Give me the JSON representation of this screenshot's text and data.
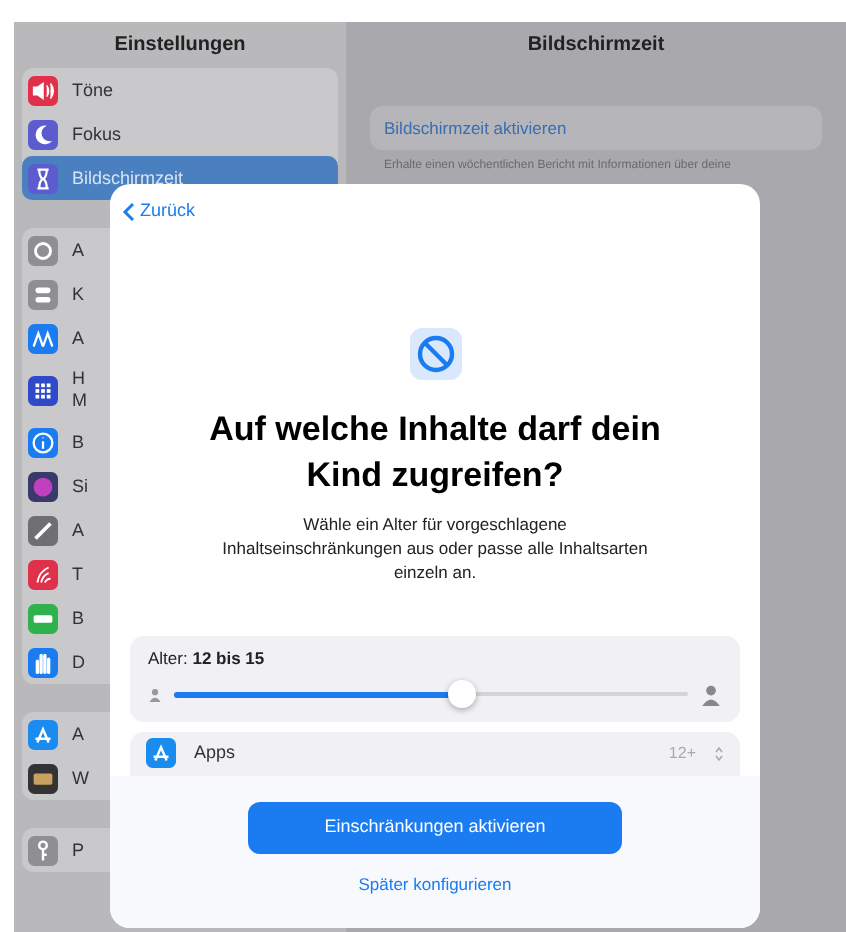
{
  "sidebar": {
    "title": "Einstellungen",
    "groups": [
      {
        "items": [
          {
            "label": "Töne",
            "selected": false
          },
          {
            "label": "Fokus",
            "selected": false
          },
          {
            "label": "Bildschirmzeit",
            "selected": true
          }
        ]
      },
      {
        "items": [
          {
            "label": "A",
            "selected": false
          },
          {
            "label": "K",
            "selected": false
          },
          {
            "label": "A",
            "selected": false
          },
          {
            "label": "H\nM",
            "selected": false
          },
          {
            "label": "B",
            "selected": false
          },
          {
            "label": "Si",
            "selected": false
          },
          {
            "label": "A",
            "selected": false
          },
          {
            "label": "T",
            "selected": false
          },
          {
            "label": "B",
            "selected": false
          },
          {
            "label": "D",
            "selected": false
          }
        ]
      },
      {
        "items": [
          {
            "label": "A",
            "selected": false
          },
          {
            "label": "W",
            "selected": false
          }
        ]
      },
      {
        "items": [
          {
            "label": "P",
            "selected": false
          }
        ]
      }
    ]
  },
  "detail": {
    "title": "Bildschirmzeit",
    "action": "Bildschirmzeit aktivieren",
    "description": "Erhalte einen wöchentlichen Bericht mit Informationen über deine"
  },
  "sheet": {
    "back": "Zurück",
    "title": "Auf welche Inhalte darf dein Kind zugreifen?",
    "description": "Wähle ein Alter für vorgeschlagene Inhaltseinschränkungen aus oder passe alle Inhaltsarten einzeln an.",
    "age": {
      "label": "Alter:",
      "value": "12 bis 15",
      "level": 0.56
    },
    "rows": [
      {
        "label": "Apps",
        "value": "12+"
      }
    ],
    "primary": "Einschränkungen aktivieren",
    "secondary": "Später konfigurieren"
  }
}
